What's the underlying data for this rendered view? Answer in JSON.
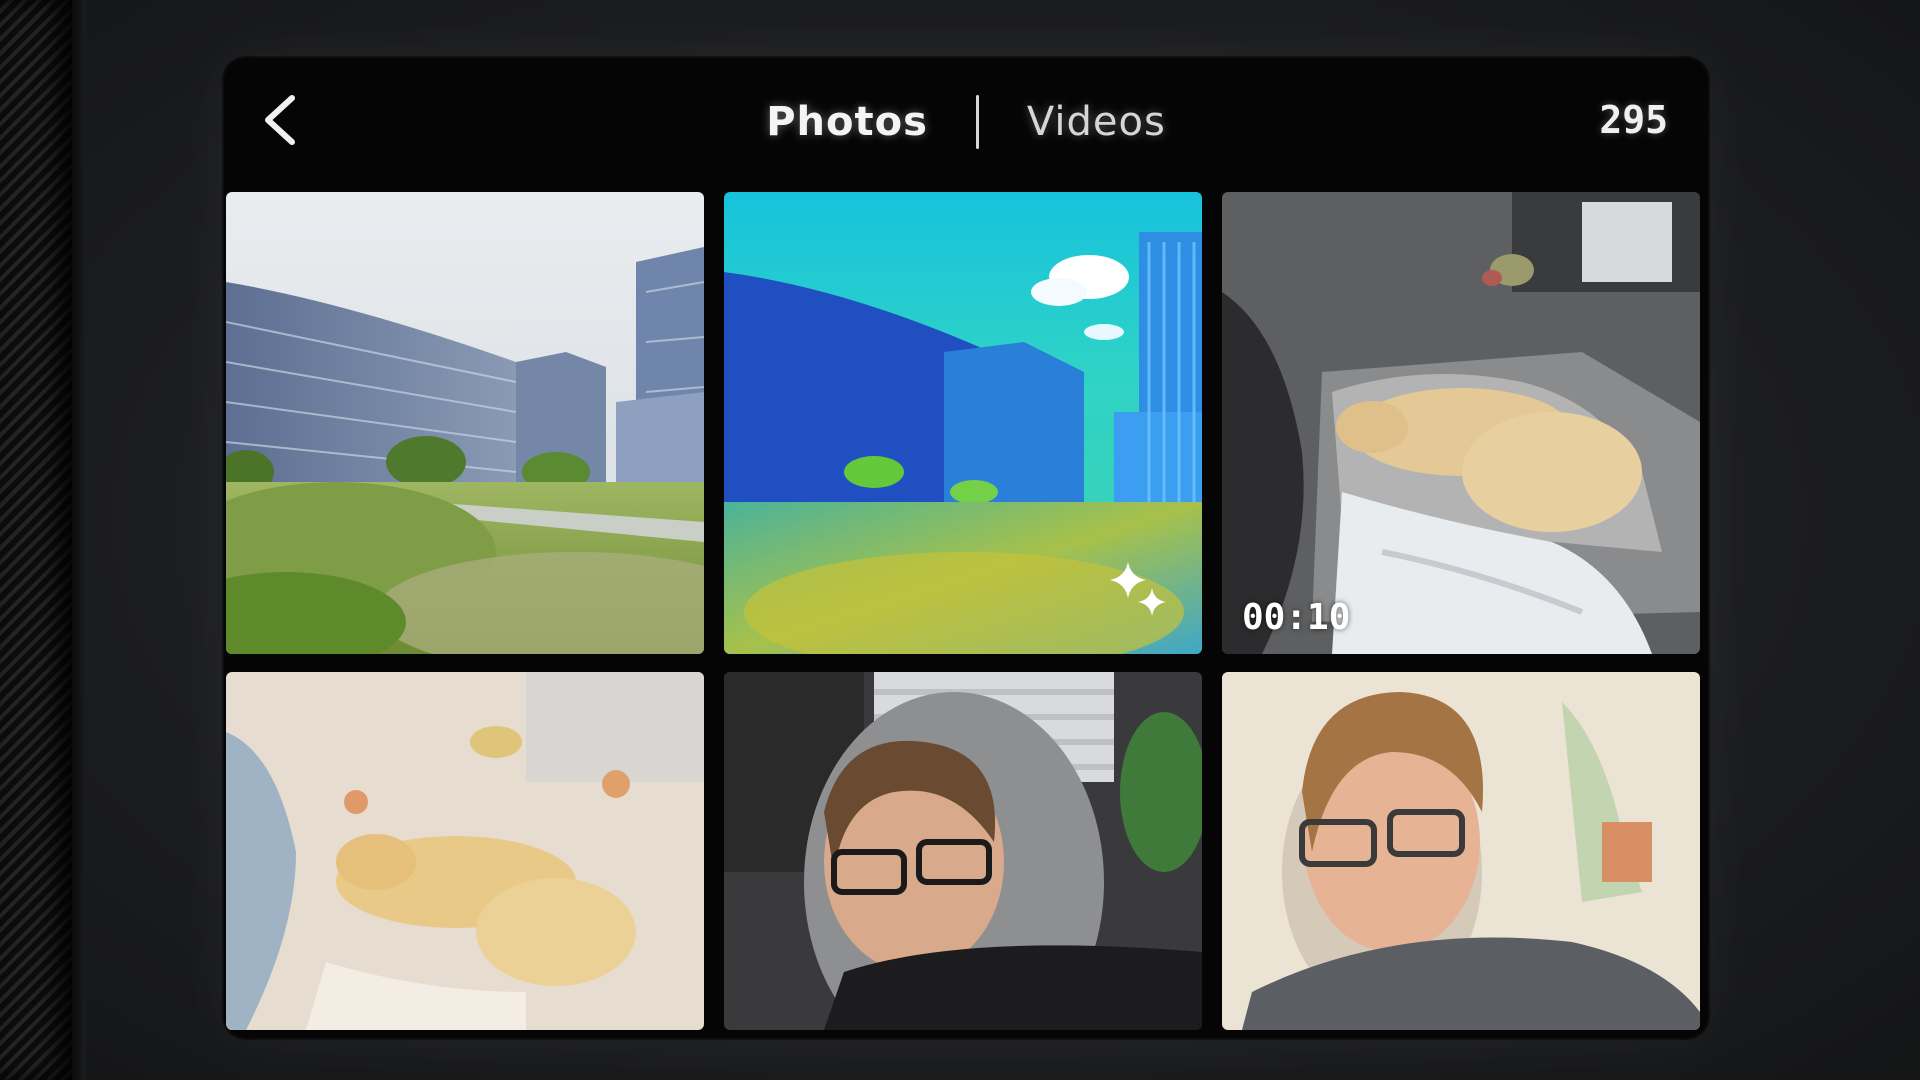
{
  "header": {
    "back_icon": "chevron-left-icon",
    "tabs": [
      {
        "label": "Photos",
        "active": true
      },
      {
        "label": "Videos",
        "active": false
      }
    ],
    "count": "295"
  },
  "gallery": {
    "items": [
      {
        "kind": "photo",
        "subject": "office buildings"
      },
      {
        "kind": "photo",
        "subject": "ai stylized buildings",
        "badge_icon": "sparkle-icon"
      },
      {
        "kind": "video",
        "subject": "sleeping dog",
        "duration": "00:10"
      },
      {
        "kind": "photo",
        "subject": "watercolor dog"
      },
      {
        "kind": "photo",
        "subject": "selfie"
      },
      {
        "kind": "photo",
        "subject": "watercolor selfie"
      }
    ]
  },
  "colors": {
    "screen_bg": "#050506",
    "text": "#f4f4f4"
  }
}
